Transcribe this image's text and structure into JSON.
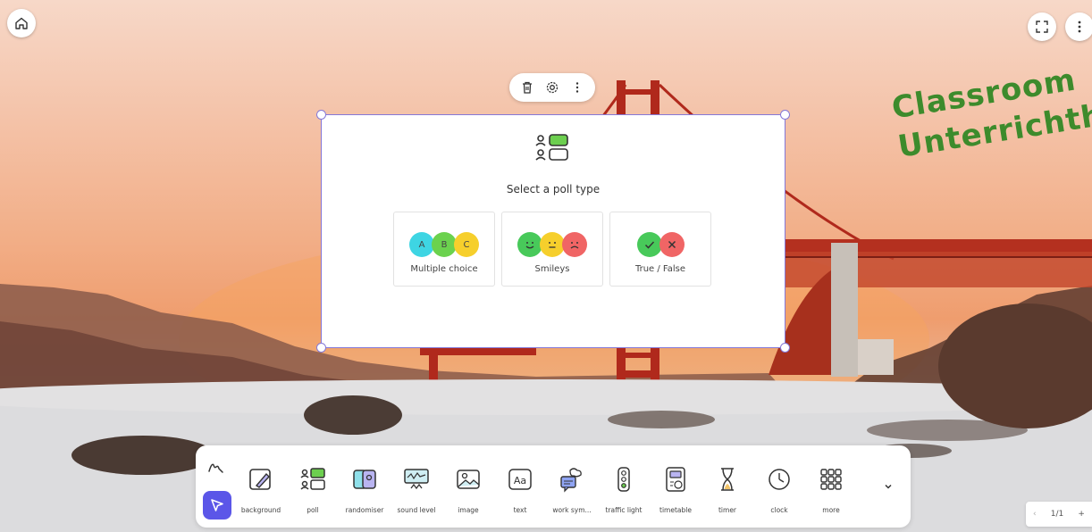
{
  "overlay": {
    "line1": "Classroom",
    "line2": "Unterrichth"
  },
  "poll": {
    "title": "Select a poll type",
    "options": [
      {
        "label": "Multiple choice",
        "circles": [
          {
            "text": "A",
            "color": "#3ed5e3"
          },
          {
            "text": "B",
            "color": "#6bd24e"
          },
          {
            "text": "C",
            "color": "#f6cf2c"
          }
        ]
      },
      {
        "label": "Smileys",
        "circles": [
          {
            "text": "",
            "color": "#48c95a"
          },
          {
            "text": "",
            "color": "#f6cf2c"
          },
          {
            "text": "",
            "color": "#f06565"
          }
        ]
      },
      {
        "label": "True / False",
        "circles": [
          {
            "text": "",
            "color": "#48c95a"
          },
          {
            "text": "",
            "color": "#f06565"
          }
        ]
      }
    ]
  },
  "dock": {
    "tools": [
      {
        "label": "background",
        "icon": "background-icon"
      },
      {
        "label": "poll",
        "icon": "poll-icon"
      },
      {
        "label": "randomiser",
        "icon": "randomiser-icon"
      },
      {
        "label": "sound level",
        "icon": "sound-level-icon"
      },
      {
        "label": "image",
        "icon": "image-icon"
      },
      {
        "label": "text",
        "icon": "text-icon"
      },
      {
        "label": "work sym...",
        "icon": "work-symbols-icon"
      },
      {
        "label": "traffic light",
        "icon": "traffic-light-icon"
      },
      {
        "label": "timetable",
        "icon": "timetable-icon"
      },
      {
        "label": "timer",
        "icon": "timer-icon"
      },
      {
        "label": "clock",
        "icon": "clock-icon"
      },
      {
        "label": "more",
        "icon": "more-grid-icon"
      }
    ]
  },
  "pager": {
    "prev": "‹",
    "current": "1/1",
    "add": "+"
  },
  "colors": {
    "accent": "#5b56e8",
    "selection": "#8478d8",
    "overlay_text": "#3d8b2c"
  }
}
